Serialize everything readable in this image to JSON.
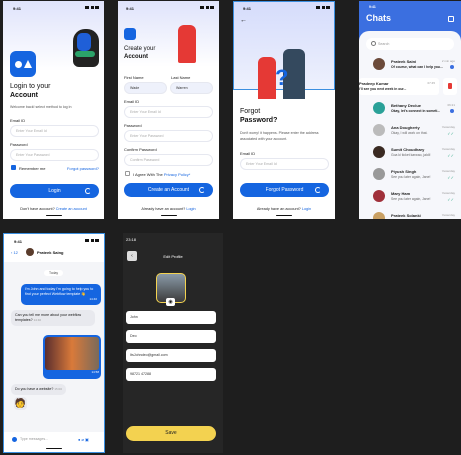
{
  "status_time": "9:41",
  "login": {
    "title_line1": "Login to your",
    "title_line2": "Account",
    "subtitle": "Welcome back! select method to log in",
    "email_label": "Email ID",
    "email_placeholder": "Enter Your Email Id",
    "password_label": "Password",
    "password_placeholder": "Enter Your Password",
    "remember": "Remember me",
    "forgot": "Forgot password?",
    "button": "Login",
    "footer_text": "Don't have account?",
    "footer_link": "Create an account"
  },
  "signup": {
    "title_line1": "Create your",
    "title_line2": "Account",
    "first_name_label": "First Name",
    "first_name_value": "Wade",
    "last_name_label": "Last Name",
    "last_name_value": "Warren",
    "email_label": "Email ID",
    "email_placeholder": "Enter Your Email Id",
    "password_label": "Password",
    "password_placeholder": "Enter Your Password",
    "confirm_label": "Confirm Password",
    "confirm_placeholder": "Confirm Password",
    "agree_text": "I Agree With The",
    "agree_link": "Privacy Policy*",
    "button": "Create an Account",
    "footer_text": "Already have an account?",
    "footer_link": "Login"
  },
  "forgot": {
    "title_line1": "Forgot",
    "title_line2": "Password?",
    "subtitle": "Don't worry! it happens. Please enter the address associated with your account.",
    "email_label": "Email ID",
    "email_placeholder": "Enter Your Email Id",
    "button": "Forgot Password",
    "footer_text": "Already have an account?",
    "footer_link": "Login"
  },
  "chats": {
    "title": "Chats",
    "search_placeholder": "Search",
    "items": [
      {
        "name": "Prateek Saini",
        "msg": "Of course, what can I help you...",
        "time": "2 min ago",
        "badge": true
      },
      {
        "name": "Pradeep Kumar",
        "msg": "I'll see you next week in our...",
        "time": "07:45"
      },
      {
        "name": "Bethany Declue",
        "msg": "Okay, let's connect in someti...",
        "time": "06:21",
        "badge": true
      },
      {
        "name": "Ana Dougherty",
        "msg": "Okay, I will work on that.",
        "time": "Yesterday"
      },
      {
        "name": "Sumit Choudhary",
        "msg": "Goa ki ticket karwao, jaldi!",
        "time": "Yesterday"
      },
      {
        "name": "Piyush Singh",
        "msg": "See you later again, Jane!",
        "time": "Yesterday"
      },
      {
        "name": "Mary Ham",
        "msg": "See you later again, Jane!",
        "time": "Yesterday"
      },
      {
        "name": "Prateek Solanki",
        "msg": "",
        "time": "Yesterday"
      }
    ]
  },
  "conversation": {
    "back_count": "12",
    "contact": "Prateek Saing",
    "day": "Today",
    "messages": [
      {
        "text": "I'm John and today I'm going to help you to find your perfect Webflow template 👋",
        "time": "14:40"
      },
      {
        "text": "Can you tell me more about your webflow templates?",
        "time": "14:40"
      },
      {
        "time": "14:58"
      },
      {
        "text": "Do you have a website?",
        "time": "15:00"
      }
    ],
    "input_placeholder": "Type messages..."
  },
  "edit_profile": {
    "time": "23:18",
    "title": "Edit Profile",
    "first_name": "John",
    "last_name": "Deo",
    "email": "ItsJohndeo@gmail.com",
    "phone": "98721 47288",
    "save": "Save"
  },
  "colors": {
    "primary": "#1565e0",
    "chats_header": "#3b6fe0",
    "save": "#f3d250",
    "dark_bg": "#1e1e1e"
  }
}
